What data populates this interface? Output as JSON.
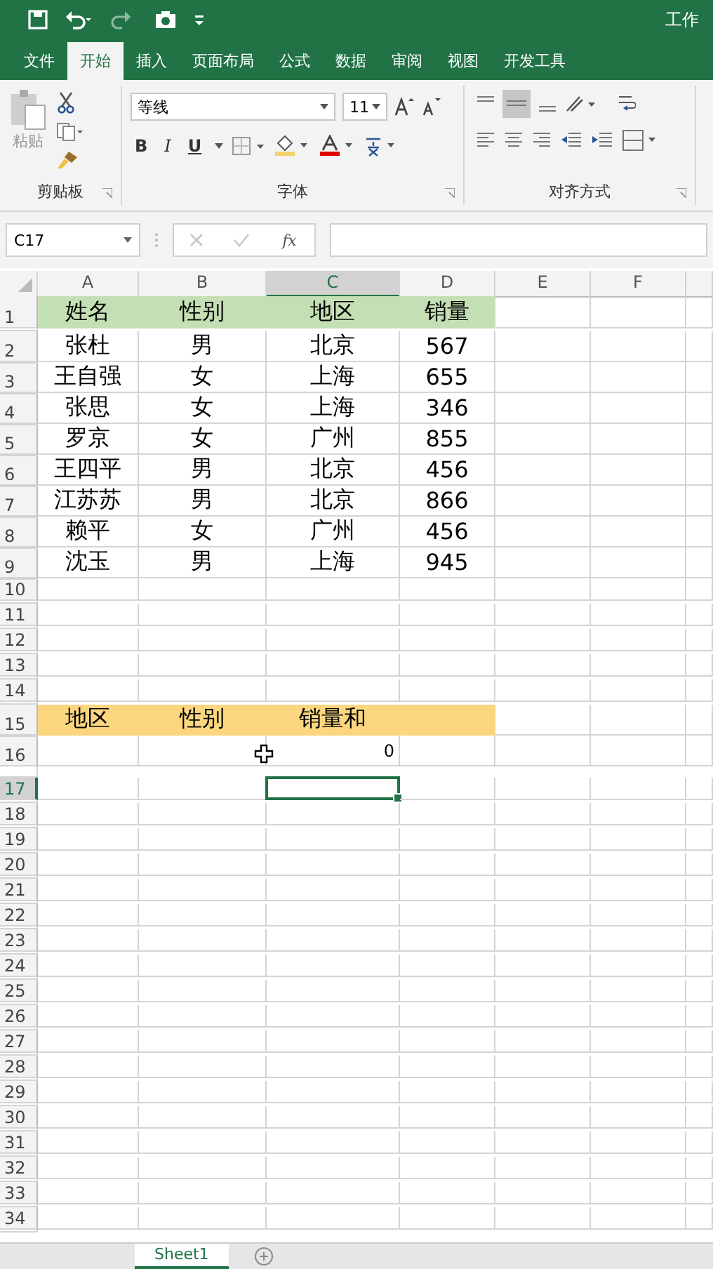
{
  "title_bar": {
    "title": "工作"
  },
  "ribbon_tabs": [
    {
      "label": "文件",
      "selected": false
    },
    {
      "label": "开始",
      "selected": true
    },
    {
      "label": "插入",
      "selected": false
    },
    {
      "label": "页面布局",
      "selected": false
    },
    {
      "label": "公式",
      "selected": false
    },
    {
      "label": "数据",
      "selected": false
    },
    {
      "label": "审阅",
      "selected": false
    },
    {
      "label": "视图",
      "selected": false
    },
    {
      "label": "开发工具",
      "selected": false
    }
  ],
  "ribbon": {
    "clipboard": {
      "paste_label": "粘贴",
      "group_label": "剪贴板"
    },
    "font": {
      "font_name": "等线",
      "font_size": "11",
      "bold": "B",
      "italic": "I",
      "underline": "U",
      "group_label": "字体"
    },
    "alignment": {
      "group_label": "对齐方式"
    }
  },
  "name_box": "C17",
  "formula_bar": {
    "fx": "fx"
  },
  "columns": [
    {
      "label": "A",
      "selected": false
    },
    {
      "label": "B",
      "selected": false
    },
    {
      "label": "C",
      "selected": true
    },
    {
      "label": "D",
      "selected": false
    },
    {
      "label": "E",
      "selected": false
    },
    {
      "label": "F",
      "selected": false
    }
  ],
  "rows": [
    {
      "number": "1",
      "kind": "green_header",
      "selected": false,
      "cells": {
        "A": "姓名",
        "B": "性别",
        "C": "地区",
        "D": "销量"
      }
    },
    {
      "number": "2",
      "kind": "data",
      "selected": false,
      "cells": {
        "A": "张杜",
        "B": "男",
        "C": "北京",
        "D": "567"
      }
    },
    {
      "number": "3",
      "kind": "data",
      "selected": false,
      "cells": {
        "A": "王自强",
        "B": "女",
        "C": "上海",
        "D": "655"
      }
    },
    {
      "number": "4",
      "kind": "data",
      "selected": false,
      "cells": {
        "A": "张思",
        "B": "女",
        "C": "上海",
        "D": "346"
      }
    },
    {
      "number": "5",
      "kind": "data",
      "selected": false,
      "cells": {
        "A": "罗京",
        "B": "女",
        "C": "广州",
        "D": "855"
      }
    },
    {
      "number": "6",
      "kind": "data",
      "selected": false,
      "cells": {
        "A": "王四平",
        "B": "男",
        "C": "北京",
        "D": "456"
      }
    },
    {
      "number": "7",
      "kind": "data",
      "selected": false,
      "cells": {
        "A": "江苏苏",
        "B": "男",
        "C": "北京",
        "D": "866"
      }
    },
    {
      "number": "8",
      "kind": "data",
      "selected": false,
      "cells": {
        "A": "赖平",
        "B": "女",
        "C": "广州",
        "D": "456"
      }
    },
    {
      "number": "9",
      "kind": "data",
      "selected": false,
      "cells": {
        "A": "沈玉",
        "B": "男",
        "C": "上海",
        "D": "945"
      }
    },
    {
      "number": "10",
      "kind": "blank",
      "selected": false
    },
    {
      "number": "11",
      "kind": "blank",
      "selected": false
    },
    {
      "number": "12",
      "kind": "blank",
      "selected": false
    },
    {
      "number": "13",
      "kind": "blank",
      "selected": false
    },
    {
      "number": "14",
      "kind": "blank",
      "selected": false
    },
    {
      "number": "15",
      "kind": "orange_header",
      "selected": false,
      "cells": {
        "A": "地区",
        "B": "性别",
        "C": "销量和"
      }
    },
    {
      "number": "16",
      "kind": "result",
      "selected": false,
      "cells": {
        "C": "0"
      }
    },
    {
      "number": "17",
      "kind": "blank",
      "selected": true
    },
    {
      "number": "18",
      "kind": "blank",
      "selected": false
    },
    {
      "number": "19",
      "kind": "blank",
      "selected": false
    },
    {
      "number": "20",
      "kind": "blank",
      "selected": false
    },
    {
      "number": "21",
      "kind": "blank",
      "selected": false
    },
    {
      "number": "22",
      "kind": "blank",
      "selected": false
    },
    {
      "number": "23",
      "kind": "blank",
      "selected": false
    },
    {
      "number": "24",
      "kind": "blank",
      "selected": false
    },
    {
      "number": "25",
      "kind": "blank",
      "selected": false
    },
    {
      "number": "26",
      "kind": "blank",
      "selected": false
    },
    {
      "number": "27",
      "kind": "blank",
      "selected": false
    },
    {
      "number": "28",
      "kind": "blank",
      "selected": false
    },
    {
      "number": "29",
      "kind": "blank",
      "selected": false
    },
    {
      "number": "30",
      "kind": "blank",
      "selected": false
    },
    {
      "number": "31",
      "kind": "blank",
      "selected": false
    },
    {
      "number": "32",
      "kind": "blank",
      "selected": false
    },
    {
      "number": "33",
      "kind": "blank",
      "selected": false
    },
    {
      "number": "34",
      "kind": "blank",
      "selected": false
    }
  ],
  "sheet_tabs": [
    {
      "label": "Sheet1",
      "selected": true
    }
  ]
}
